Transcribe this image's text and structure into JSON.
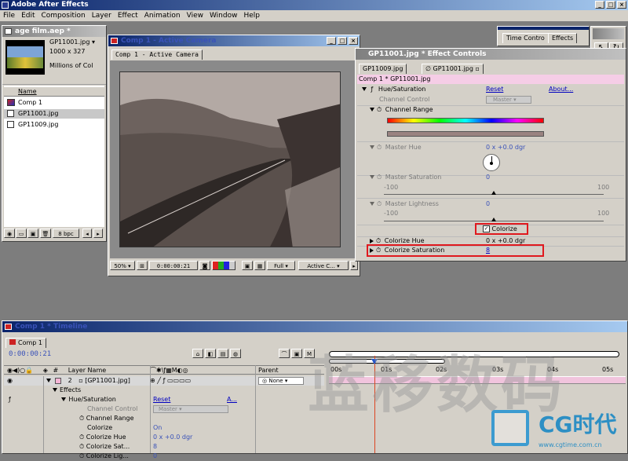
{
  "app": {
    "title": "Adobe After Effects",
    "menu": [
      "File",
      "Edit",
      "Composition",
      "Layer",
      "Effect",
      "Animation",
      "View",
      "Window",
      "Help"
    ]
  },
  "project": {
    "title": "age film.aep *",
    "thumb_name": "GP11001.jpg ▾",
    "thumb_dims": "1000 x 327",
    "thumb_colors": "Millions of Col",
    "col_name": "Name",
    "items": [
      "Comp 1",
      "GP11001.jpg",
      "GP11009.jpg"
    ],
    "bpc": "8 bpc"
  },
  "comp_window": {
    "title": "Comp 1 - Active Camera",
    "tab": "Comp 1 - Active Camera",
    "zoom": "50%",
    "timecode": "0:00:00:21",
    "resolution": "Full",
    "camera": "Active C..."
  },
  "palette": {
    "tabs": [
      "Time Contro",
      "Effects"
    ]
  },
  "effect_controls": {
    "title": "GP11001.jpg * Effect Controls",
    "tabs": [
      "GP11009.jpg",
      "GP11001.jpg"
    ],
    "breadcrumb": "Comp 1 * GP11001.jpg",
    "effect_name": "Hue/Saturation",
    "reset": "Reset",
    "about": "About...",
    "channel_control_label": "Channel Control",
    "channel_control_value": "Master",
    "channel_range": "Channel Range",
    "master_hue_label": "Master Hue",
    "master_hue_value": "0 x +0.0 dgr",
    "master_sat_label": "Master Saturation",
    "master_sat_value": "0",
    "slider_min": "-100",
    "slider_max": "100",
    "master_light_label": "Master Lightness",
    "master_light_value": "0",
    "colorize_label": "Colorize",
    "colorize_hue_label": "Colorize Hue",
    "colorize_hue_value": "0 x +0.0 dgr",
    "colorize_sat_label": "Colorize Saturation",
    "colorize_sat_value": "8",
    "colors": {
      "highlight": "#e0191e"
    }
  },
  "timeline": {
    "title": "Comp 1 * Timeline",
    "tab": "Comp 1",
    "timecode": "0:00:00:21",
    "col_layer_name": "Layer Name",
    "col_parent": "Parent",
    "time_marks": [
      "00s",
      "01s",
      "02s",
      "03s",
      "04s",
      "05s"
    ],
    "layer_num": "2",
    "layer_name": "[GP11001.jpg]",
    "parent_value": "None",
    "effects": "Effects",
    "hue_sat": "Hue/Saturation",
    "reset": "Reset",
    "about": "A...",
    "channel_control": "Channel Control",
    "channel_control_value": "Master",
    "channel_range": "Channel Range",
    "colorize": "Colorize",
    "colorize_value": "On",
    "colorize_hue": "Colorize Hue",
    "colorize_hue_value": "0 x +0.0 dgr",
    "colorize_sat": "Colorize Sat...",
    "colorize_sat_value": "8",
    "colorize_lig": "Colorize Lig...",
    "colorize_lig_value": "0"
  },
  "watermark": {
    "cjk": "蓝移数码",
    "brand": "CG时代",
    "url": "www.cgtime.com.cn"
  }
}
